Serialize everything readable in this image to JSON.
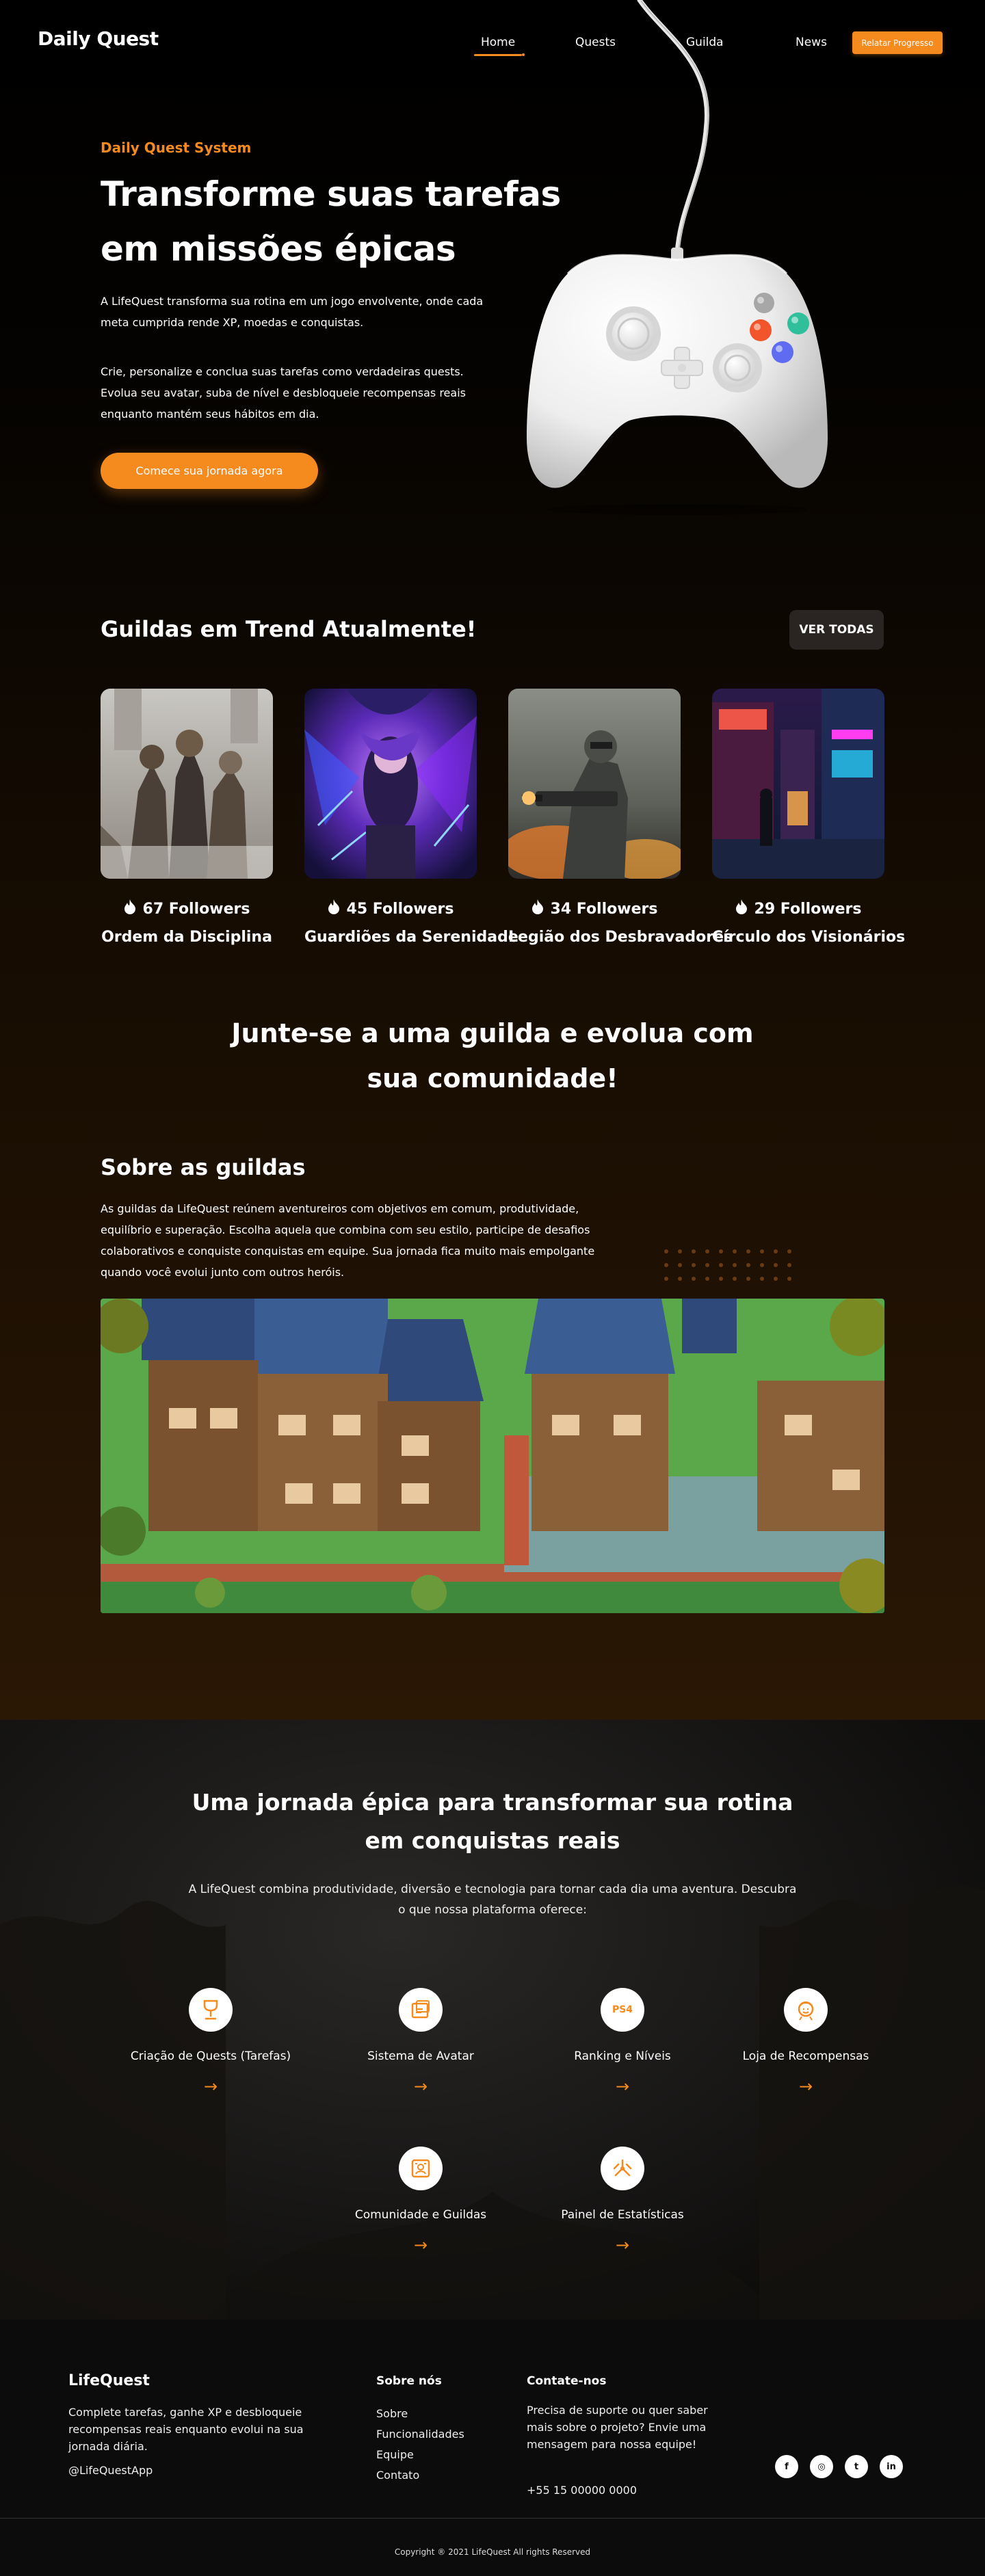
{
  "header": {
    "logo": "Daily Quest",
    "nav": [
      {
        "label": "Home",
        "active": true
      },
      {
        "label": "Quests"
      },
      {
        "label": "Guilda"
      },
      {
        "label": "News"
      }
    ],
    "report_button": "Relatar Progresso"
  },
  "hero": {
    "tag": "Daily Quest System",
    "title": "Transforme suas tarefas em missões épicas",
    "p1": "A LifeQuest transforma sua rotina em um jogo envolvente, onde cada meta cumprida rende XP, moedas e conquistas.",
    "p2": "Crie, personalize e conclua suas tarefas como verdadeiras quests. Evolua seu avatar, suba de nível e desbloqueie recompensas reais enquanto mantém seus hábitos em dia.",
    "cta": "Comece sua jornada agora"
  },
  "guilds": {
    "title": "Guildas em Trend Atualmente!",
    "see_all": "VER TODAS",
    "items": [
      {
        "followers": "67 Followers",
        "name": "Ordem da Disciplina"
      },
      {
        "followers": "45 Followers",
        "name": "Guardiões da Serenidade"
      },
      {
        "followers": "34 Followers",
        "name": "Legião dos Desbravadores"
      },
      {
        "followers": "29 Followers",
        "name": "Círculo dos Visionários"
      }
    ]
  },
  "join": {
    "title": "Junte-se a uma guilda e evolua com sua comunidade!"
  },
  "about": {
    "title": "Sobre as guildas",
    "text": "As guildas da LifeQuest reúnem aventureiros com objetivos em comum, produtividade, equilíbrio e superação. Escolha aquela que combina com seu estilo, participe de desafios colaborativos e conquiste conquistas em equipe. Sua jornada fica muito mais empolgante quando você evolui junto com outros heróis."
  },
  "features": {
    "title": "Uma jornada épica para transformar sua rotina em conquistas reais",
    "subtitle": "A LifeQuest combina produtividade, diversão e tecnologia para tornar cada dia uma aventura. Descubra o que nossa plataforma oferece:",
    "items": [
      {
        "label": "Criação de Quests (Tarefas)",
        "icon": "quest-icon"
      },
      {
        "label": "Sistema de Avatar",
        "icon": "avatar-icon"
      },
      {
        "label": "Ranking e Níveis",
        "icon": "ps4-icon",
        "icon_text": "PS4"
      },
      {
        "label": "Loja de Recompensas",
        "icon": "rewards-icon"
      },
      {
        "label": "Comunidade e Guildas",
        "icon": "community-icon"
      },
      {
        "label": "Painel de Estatísticas",
        "icon": "stats-icon"
      }
    ],
    "arrow": "→"
  },
  "footer": {
    "brand": "LifeQuest",
    "desc": "Complete tarefas, ganhe XP e desbloqueie recompensas reais enquanto evolui na sua jornada diária.",
    "handle": "@LifeQuestApp",
    "about_title": "Sobre nós",
    "links": [
      "Sobre",
      "Funcionalidades",
      "Equipe",
      "Contato"
    ],
    "contact_title": "Contate-nos",
    "contact_text": "Precisa de suporte ou quer saber mais sobre o projeto? Envie uma mensagem para nossa equipe!",
    "phone": "+55 15 00000 0000",
    "socials": [
      {
        "icon": "facebook-icon",
        "glyph": "f"
      },
      {
        "icon": "instagram-icon",
        "glyph": "◎"
      },
      {
        "icon": "twitter-icon",
        "glyph": "t"
      },
      {
        "icon": "linkedin-icon",
        "glyph": "in"
      }
    ],
    "copyright": "Copyright ® 2021 LifeQuest All rights Reserved"
  },
  "colors": {
    "accent": "#f58a1f",
    "background": "#000000",
    "footer": "#0c0c0c"
  }
}
